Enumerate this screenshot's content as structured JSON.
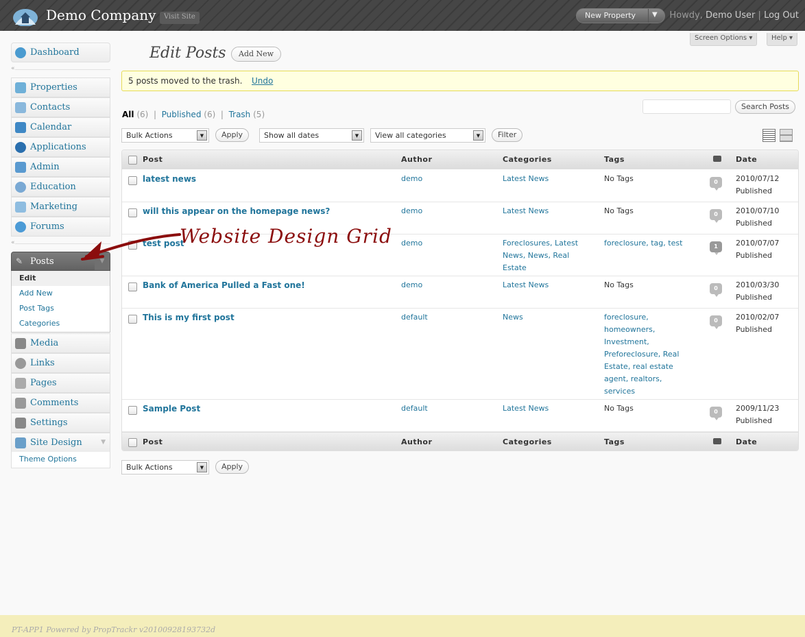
{
  "header": {
    "site_title": "Demo Company",
    "visit_site": "Visit Site",
    "new_property": "New Property",
    "howdy": "Howdy,",
    "user": "Demo User",
    "logout": "Log Out"
  },
  "screen_options": "Screen Options",
  "help": "Help",
  "sidebar": {
    "dashboard": "Dashboard",
    "items": [
      {
        "label": "Properties",
        "icon": "properties-icon"
      },
      {
        "label": "Contacts",
        "icon": "contacts-icon"
      },
      {
        "label": "Calendar",
        "icon": "calendar-icon"
      },
      {
        "label": "Applications",
        "icon": "applications-icon"
      },
      {
        "label": "Admin",
        "icon": "admin-icon"
      },
      {
        "label": "Education",
        "icon": "education-icon"
      },
      {
        "label": "Marketing",
        "icon": "marketing-icon"
      },
      {
        "label": "Forums",
        "icon": "forums-icon"
      }
    ],
    "posts": "Posts",
    "posts_sub": [
      "Edit",
      "Add New",
      "Post Tags",
      "Categories"
    ],
    "items2": [
      {
        "label": "Media",
        "icon": "media-icon"
      },
      {
        "label": "Links",
        "icon": "links-icon"
      },
      {
        "label": "Pages",
        "icon": "pages-icon"
      },
      {
        "label": "Comments",
        "icon": "comments-icon"
      },
      {
        "label": "Settings",
        "icon": "settings-icon"
      },
      {
        "label": "Site Design",
        "icon": "site-design-icon"
      }
    ],
    "theme_options": "Theme Options"
  },
  "main": {
    "title": "Edit Posts",
    "add_new": "Add New",
    "notice": "5 posts moved to the trash.",
    "undo": "Undo",
    "filters": {
      "all": "All",
      "all_count": "(6)",
      "published": "Published",
      "published_count": "(6)",
      "trash": "Trash",
      "trash_count": "(5)"
    },
    "search_button": "Search Posts",
    "bulk_actions": "Bulk Actions",
    "apply": "Apply",
    "show_all_dates": "Show all dates",
    "view_all_categories": "View all categories",
    "filter": "Filter",
    "columns": [
      "Post",
      "Author",
      "Categories",
      "Tags",
      "Date"
    ],
    "rows": [
      {
        "title": "latest news",
        "author": "demo",
        "categories": "Latest News",
        "tags": "No Tags",
        "comments": "0",
        "date": "2010/07/12",
        "status": "Published"
      },
      {
        "title": "will this appear on the homepage news?",
        "author": "demo",
        "categories": "Latest News",
        "tags": "No Tags",
        "comments": "0",
        "date": "2010/07/10",
        "status": "Published"
      },
      {
        "title": "test post",
        "author": "demo",
        "categories": "Foreclosures, Latest News, News, Real Estate",
        "tags": "foreclosure, tag, test",
        "comments": "1",
        "date": "2010/07/07",
        "status": "Published"
      },
      {
        "title": "Bank of America Pulled a Fast one!",
        "author": "demo",
        "categories": "Latest News",
        "tags": "No Tags",
        "comments": "0",
        "date": "2010/03/30",
        "status": "Published"
      },
      {
        "title": "This is my first post",
        "author": "default",
        "categories": "News",
        "tags": "foreclosure, homeowners, Investment, Preforeclosure, Real Estate, real estate agent, realtors, services",
        "comments": "0",
        "date": "2010/02/07",
        "status": "Published"
      },
      {
        "title": "Sample Post",
        "author": "default",
        "categories": "Latest News",
        "tags": "No Tags",
        "comments": "0",
        "date": "2009/11/23",
        "status": "Published"
      }
    ]
  },
  "annotation": "Website Design Grid",
  "footer": "PT-APP1 Powered by PropTrackr v20100928193732d",
  "colors": {
    "link": "#21759b",
    "header": "#464646",
    "notice_bg": "#ffffe0",
    "footer_bg": "#f4eebb",
    "annotation": "#8b0d0d"
  }
}
